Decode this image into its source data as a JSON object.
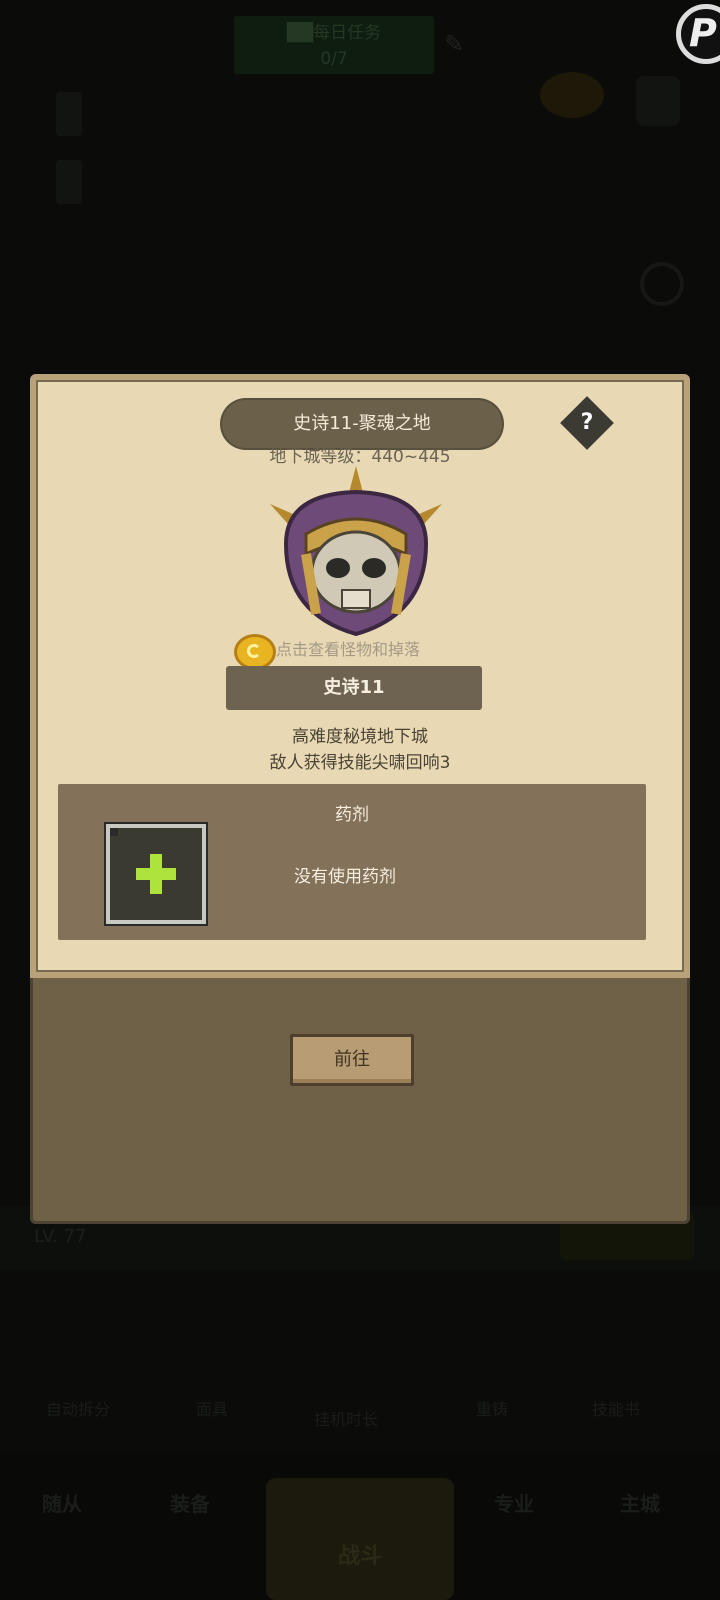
{
  "background": {
    "top_banner_line1": "██每日任务",
    "top_banner_line2": "0/7",
    "bottom_level": "LV. 77",
    "sub_nav": [
      "自动拆分",
      "面具",
      "挂机时长",
      "重铸",
      "技能书"
    ],
    "main_nav": [
      "随从",
      "装备",
      "战斗",
      "专业",
      "主城"
    ]
  },
  "dialog": {
    "title": "史诗11-聚魂之地",
    "help_label": "?",
    "level_range": "地下城等级：440~445",
    "hint": "点击查看怪物和掉落",
    "dungeon_name": "史诗11",
    "description_line1": "高难度秘境地下城",
    "description_line2": "敌人获得技能尖啸回响3",
    "potion_title": "药剂",
    "potion_status": "没有使用药剂",
    "go_button": "前往"
  },
  "colors": {
    "parchment": "#e9d8b4",
    "panel_brown": "#83715a",
    "plus_green": "#aee23c"
  }
}
